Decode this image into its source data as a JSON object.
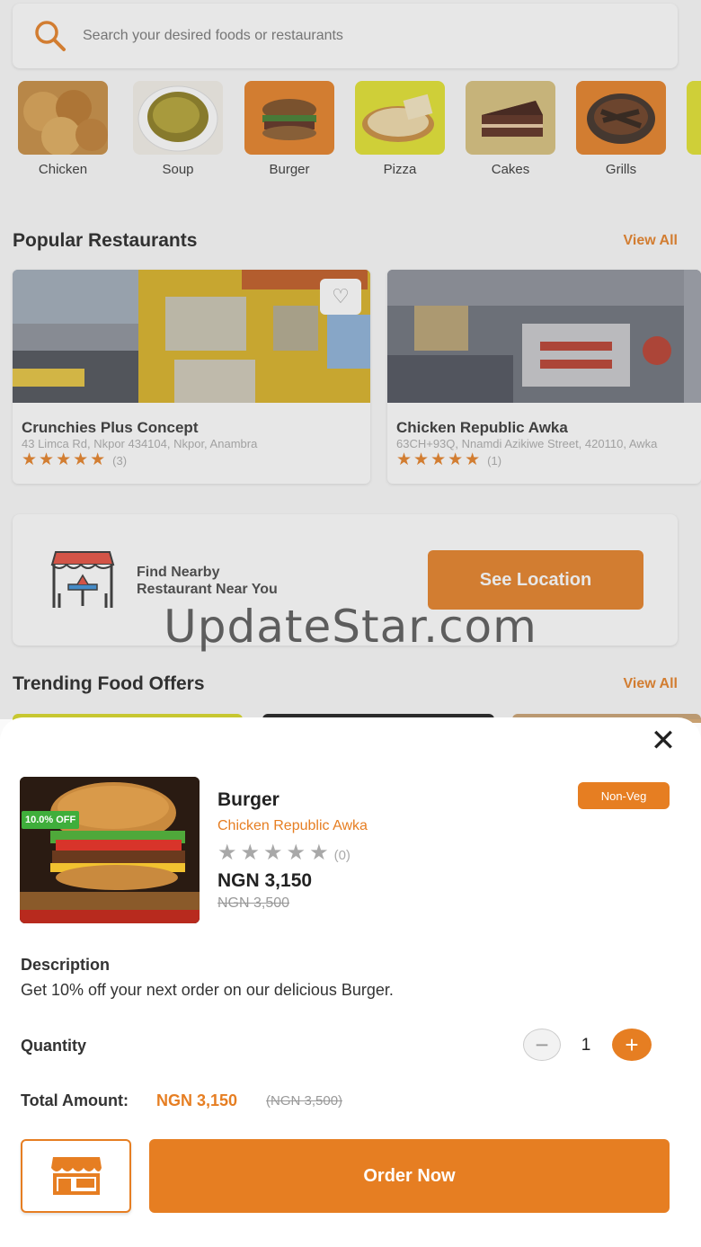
{
  "search": {
    "placeholder": "Search your desired foods or restaurants",
    "icon": "search-icon"
  },
  "categories": [
    {
      "label": "Chicken"
    },
    {
      "label": "Soup"
    },
    {
      "label": "Burger"
    },
    {
      "label": "Pizza"
    },
    {
      "label": "Cakes"
    },
    {
      "label": "Grills"
    }
  ],
  "popular": {
    "title": "Popular Restaurants",
    "view_all": "View All",
    "restaurants": [
      {
        "name": "Crunchies Plus Concept",
        "address": "43 Limca Rd, Nkpor 434104, Nkpor, Anambra",
        "stars": "★★★★★",
        "count": "(3)"
      },
      {
        "name": "Chicken Republic Awka",
        "address": "63CH+93Q, Nnamdi Azikiwe Street, 420110, Awka",
        "stars": "★★★★★",
        "count": "(1)"
      }
    ]
  },
  "nearby": {
    "line1": "Find Nearby",
    "line2": "Restaurant Near You",
    "button": "See Location"
  },
  "trending": {
    "title": "Trending Food Offers",
    "view_all": "View All"
  },
  "watermark": "UpdateStar.com",
  "sheet": {
    "close_icon": "✕",
    "discount": "10.0% OFF",
    "title": "Burger",
    "restaurant": "Chicken Republic Awka",
    "stars": "★★★★★",
    "rating_count": "(0)",
    "price": "NGN 3,150",
    "old_price": "NGN 3,500",
    "badge": "Non-Veg",
    "description_label": "Description",
    "description": "Get 10% off your next order on our delicious Burger.",
    "quantity_label": "Quantity",
    "quantity": "1",
    "minus": "−",
    "plus": "+",
    "total_label": "Total Amount:",
    "total_value": "NGN 3,150",
    "total_old": "(NGN 3,500)",
    "order_button": "Order Now"
  },
  "colors": {
    "accent": "#e67e22",
    "discount": "#3fae3b"
  }
}
